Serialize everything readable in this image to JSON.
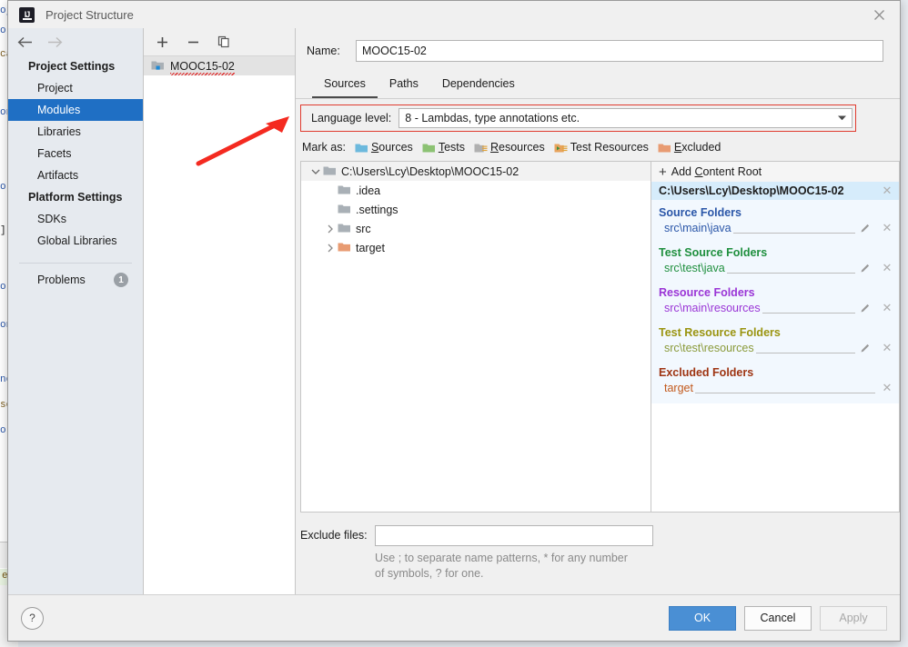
{
  "window": {
    "title": "Project Structure",
    "logo_text": "IJ",
    "close_icon": "close-icon"
  },
  "sidebar": {
    "back_icon": "arrow-left-icon",
    "forward_icon": "arrow-right-icon",
    "groups": [
      {
        "label": "Project Settings",
        "items": [
          {
            "label": "Project",
            "selected": false
          },
          {
            "label": "Modules",
            "selected": true
          },
          {
            "label": "Libraries",
            "selected": false
          },
          {
            "label": "Facets",
            "selected": false
          },
          {
            "label": "Artifacts",
            "selected": false
          }
        ]
      },
      {
        "label": "Platform Settings",
        "items": [
          {
            "label": "SDKs",
            "selected": false
          },
          {
            "label": "Global Libraries",
            "selected": false
          }
        ]
      }
    ],
    "problems": {
      "label": "Problems",
      "count": "1"
    }
  },
  "modules_panel": {
    "toolbar": {
      "add_icon": "plus-icon",
      "remove_icon": "minus-icon",
      "copy_icon": "copy-icon"
    },
    "items": [
      {
        "name": "MOOC15-02",
        "icon": "module-folder-icon",
        "selected": true,
        "error": true
      }
    ]
  },
  "main": {
    "name_label": "Name:",
    "name_value": "MOOC15-02",
    "tabs": [
      {
        "label": "Sources",
        "active": true
      },
      {
        "label": "Paths",
        "active": false
      },
      {
        "label": "Dependencies",
        "active": false
      }
    ],
    "language_level": {
      "label": "Language level:",
      "value": "8 - Lambdas, type annotations etc.",
      "dropdown_icon": "chevron-down-icon",
      "highlight_color": "#e03b2f"
    },
    "mark_as": {
      "label": "Mark as:",
      "options": [
        {
          "label": "Sources",
          "accel": "S",
          "color": "#6cb9dd",
          "icon": "folder-sources-icon"
        },
        {
          "label": "Tests",
          "accel": "T",
          "color": "#8cc273",
          "icon": "folder-tests-icon"
        },
        {
          "label": "Resources",
          "accel": "R",
          "color": "#b0b0b0",
          "icon": "folder-resources-icon"
        },
        {
          "label": "Test Resources",
          "accel": "",
          "color": "#e8a35c",
          "icon": "folder-test-resources-icon"
        },
        {
          "label": "Excluded",
          "accel": "E",
          "color": "#e89b72",
          "icon": "folder-excluded-icon"
        }
      ]
    },
    "tree": [
      {
        "label": "C:\\Users\\Lcy\\Desktop\\MOOC15-02",
        "depth": 0,
        "twisty": "expanded",
        "color": "#a9b0b6",
        "selected": true
      },
      {
        "label": ".idea",
        "depth": 1,
        "twisty": "none",
        "color": "#a9b0b6",
        "selected": false
      },
      {
        "label": ".settings",
        "depth": 1,
        "twisty": "none",
        "color": "#a9b0b6",
        "selected": false
      },
      {
        "label": "src",
        "depth": 1,
        "twisty": "collapsed",
        "color": "#a9b0b6",
        "selected": false
      },
      {
        "label": "target",
        "depth": 1,
        "twisty": "collapsed",
        "color": "#e89b72",
        "selected": false
      }
    ],
    "content_root_panel": {
      "add_label": "Add Content Root",
      "add_icon": "plus-icon",
      "root_path": "C:\\Users\\Lcy\\Desktop\\MOOC15-02",
      "groups": [
        {
          "title": "Source Folders",
          "color": "#2a56a8",
          "entries": [
            {
              "path": "src\\main\\java",
              "has_edit": true,
              "has_remove": true
            }
          ]
        },
        {
          "title": "Test Source Folders",
          "color": "#1f8f3e",
          "entries": [
            {
              "path": "src\\test\\java",
              "has_edit": true,
              "has_remove": true
            }
          ]
        },
        {
          "title": "Resource Folders",
          "color": "#9a35d6",
          "entries": [
            {
              "path": "src\\main\\resources",
              "has_edit": true,
              "has_remove": true
            }
          ]
        },
        {
          "title": "Test Resource Folders",
          "color": "#9a9410",
          "entries": [
            {
              "path": "src\\test\\resources",
              "has_edit": true,
              "has_remove": true
            }
          ]
        },
        {
          "title": "Excluded Folders",
          "color": "#9e3412",
          "entries": [
            {
              "path": "target",
              "has_edit": false,
              "has_remove": true
            }
          ]
        }
      ],
      "edit_icon": "pencil-icon",
      "remove_icon": "close-icon"
    },
    "exclude_files": {
      "label": "Exclude files:",
      "value": "",
      "placeholder": "",
      "hint_line1": "Use ; to separate name patterns, * for any number",
      "hint_line2": "of symbols, ? for one."
    }
  },
  "footer": {
    "help_label": "?",
    "help_icon": "help-icon",
    "buttons": [
      {
        "label": "OK",
        "style": "primary"
      },
      {
        "label": "Cancel",
        "style": "normal"
      },
      {
        "label": "Apply",
        "style": "disabled"
      }
    ]
  },
  "background": {
    "code_fragments": [
      "oj",
      "o ;",
      "ca",
      "on",
      "o ;",
      "]]",
      "o ;",
      "on",
      "ne",
      "so",
      "or",
      "e"
    ]
  }
}
